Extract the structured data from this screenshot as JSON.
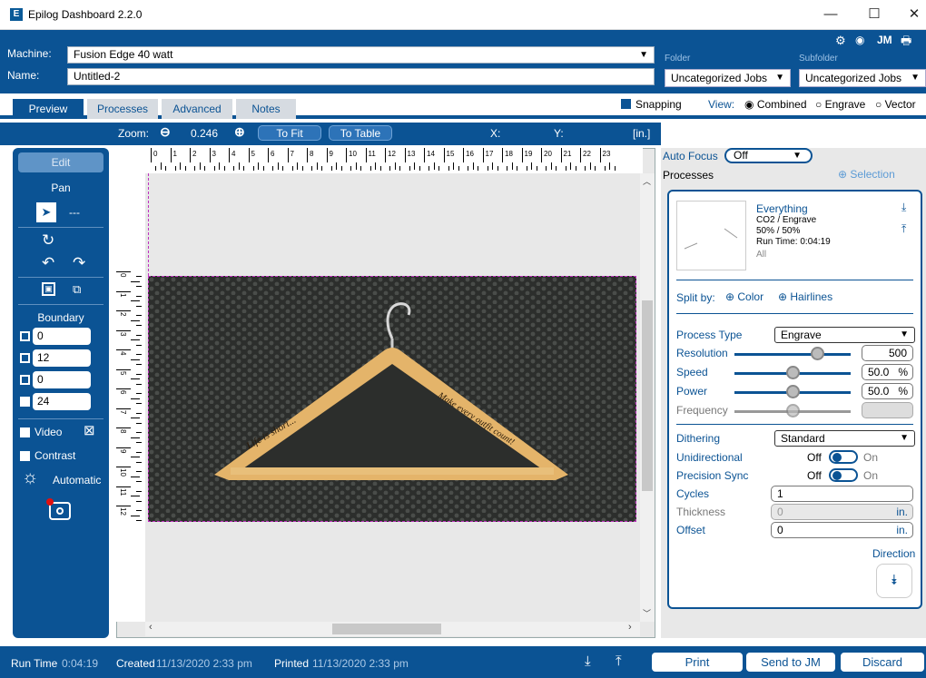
{
  "window": {
    "title": "Epilog Dashboard 2.2.0",
    "logo_glyph": "E",
    "minimize": "—",
    "maximize": "☐",
    "close": "✕"
  },
  "header": {
    "machine_label": "Machine:",
    "machine_value": "Fusion Edge 40 watt",
    "name_label": "Name:",
    "name_value": "Untitled-2",
    "folder_label": "Folder",
    "folder_value": "Uncategorized Jobs",
    "subfolder_label": "Subfolder",
    "subfolder_value": "Uncategorized Jobs",
    "user_initials": "JM",
    "dropdown_glyph": "▼"
  },
  "tabs": [
    {
      "label": "Preview"
    },
    {
      "label": "Processes"
    },
    {
      "label": "Advanced"
    },
    {
      "label": "Notes"
    }
  ],
  "view": {
    "snapping_label": "Snapping",
    "view_label": "View:",
    "combined": "Combined",
    "engrave": "Engrave",
    "vector": "Vector"
  },
  "zoom": {
    "label": "Zoom:",
    "value": "0.246",
    "to_fit": "To Fit",
    "to_table": "To Table",
    "x_label": "X:",
    "y_label": "Y:",
    "units": "[in.]"
  },
  "left_panel": {
    "edit": "Edit",
    "pan": "Pan",
    "tool_value": "---",
    "boundary": "Boundary",
    "boundary_values": [
      "0",
      "12",
      "0",
      "24"
    ],
    "video": "Video",
    "contrast": "Contrast",
    "automatic": "Automatic"
  },
  "ruler": {
    "top": [
      "0",
      "1",
      "2",
      "3",
      "4",
      "5",
      "6",
      "7",
      "8",
      "9",
      "10",
      "11",
      "12",
      "13",
      "14",
      "15",
      "16",
      "17",
      "18",
      "19",
      "20",
      "21",
      "22",
      "23"
    ],
    "left": [
      "0",
      "1",
      "2",
      "3",
      "4",
      "5",
      "6",
      "7",
      "8",
      "9",
      "10",
      "11",
      "12"
    ]
  },
  "hanger": {
    "left_text": "Life is short...",
    "right_text": "Make every outfit count!"
  },
  "right_panel": {
    "auto_focus_label": "Auto Focus",
    "auto_focus_value": "Off",
    "processes_label": "Processes",
    "selection_label": "Selection",
    "process_name": "Everything",
    "process_type_line": "CO2 / Engrave",
    "process_percent": "50% / 50%",
    "run_time_line": "Run Time: 0:04:19",
    "all_label": "All",
    "split_by": "Split by:",
    "color": "Color",
    "hairlines": "Hairlines",
    "process_type_label": "Process Type",
    "process_type_value": "Engrave",
    "resolution_label": "Resolution",
    "resolution_value": "500",
    "speed_label": "Speed",
    "speed_value": "50.0",
    "power_label": "Power",
    "power_value": "50.0",
    "percent": "%",
    "frequency_label": "Frequency",
    "dithering_label": "Dithering",
    "dithering_value": "Standard",
    "unidirectional_label": "Unidirectional",
    "precision_sync_label": "Precision Sync",
    "off": "Off",
    "on": "On",
    "cycles_label": "Cycles",
    "cycles_value": "1",
    "thickness_label": "Thickness",
    "thickness_value": "0",
    "offset_label": "Offset",
    "offset_value": "0",
    "unit_in": "in.",
    "direction_label": "Direction"
  },
  "status": {
    "run_time_label": "Run Time",
    "run_time_value": "0:04:19",
    "created_label": "Created",
    "created_value": "11/13/2020 2:33 pm",
    "printed_label": "Printed",
    "printed_value": "11/13/2020 2:33 pm",
    "print": "Print",
    "send": "Send to JM",
    "discard": "Discard"
  },
  "colors": {
    "brand_blue": "#0b5394",
    "bed_grid": "#2f312f",
    "hanger_wood": "#e4b46a"
  }
}
